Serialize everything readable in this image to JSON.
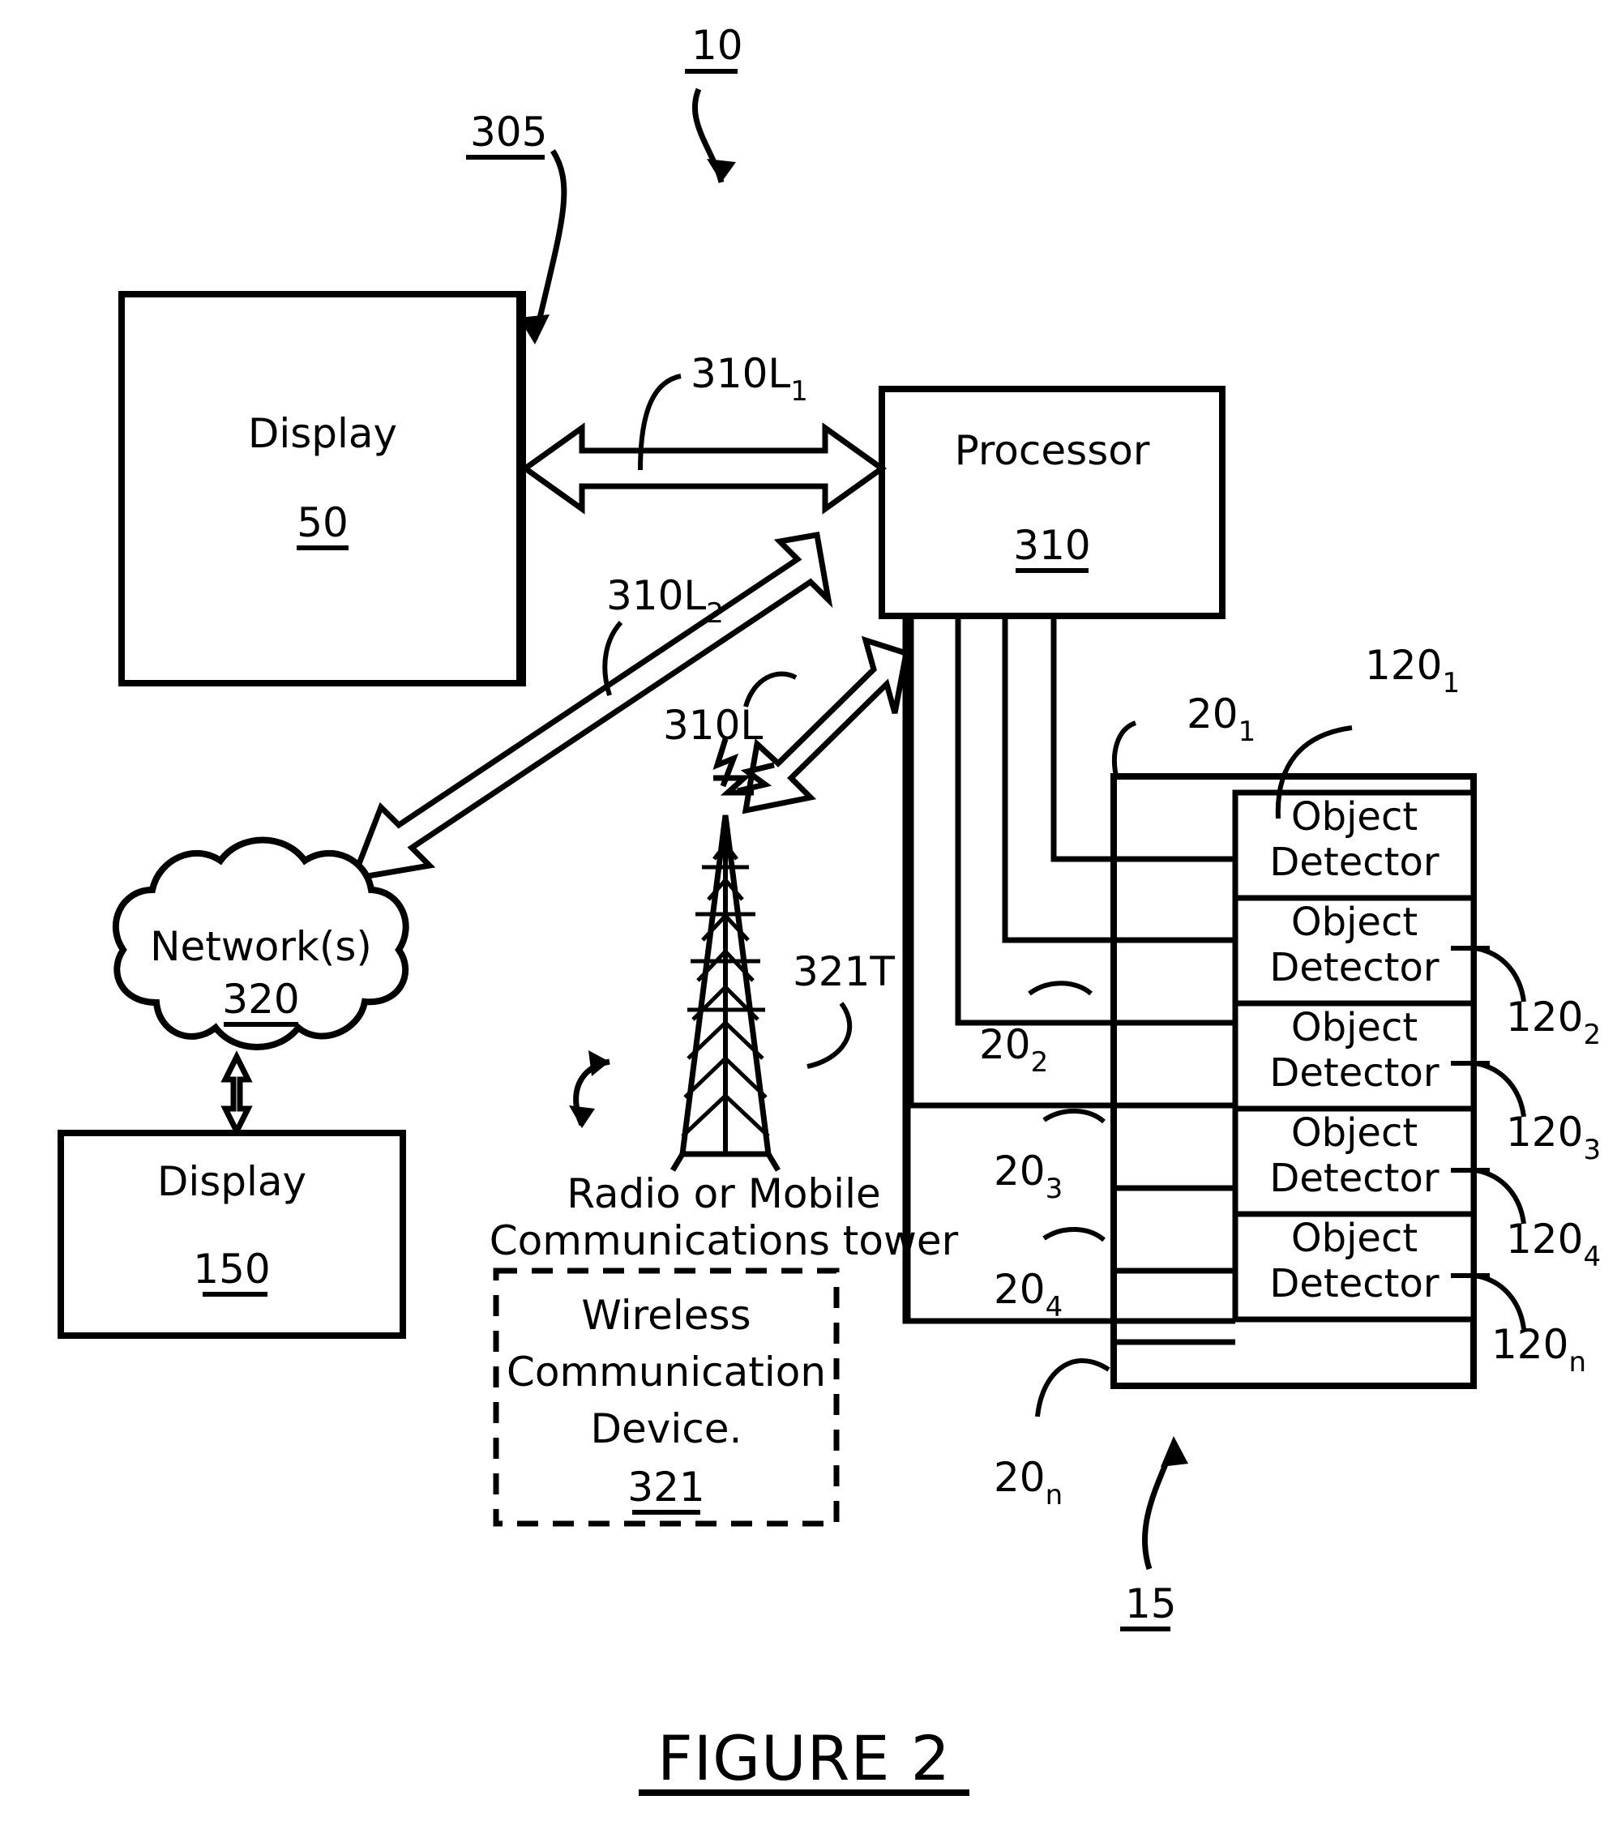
{
  "figure": {
    "caption": "FIGURE 2",
    "system_ref": "10"
  },
  "blocks": {
    "display_top": {
      "label": "Display",
      "ref": "50",
      "bezel_ref": "305"
    },
    "processor": {
      "label": "Processor",
      "ref": "310"
    },
    "network": {
      "label": "Network(s)",
      "ref": "320"
    },
    "display_bottom": {
      "label": "Display",
      "ref": "150"
    },
    "tower": {
      "caption_line1": "Radio or Mobile",
      "caption_line2": "Communications tower",
      "ref": "321T"
    },
    "wireless_device": {
      "line1": "Wireless",
      "line2": "Communication",
      "line3": "Device.",
      "ref": "321"
    },
    "detector_array": {
      "ref": "15"
    }
  },
  "links": {
    "display_processor": {
      "base": "310L",
      "sub": "1"
    },
    "network_processor": {
      "base": "310L",
      "sub": "2"
    },
    "tower_processor": {
      "base": "310L",
      "sub": ""
    }
  },
  "detectors": [
    {
      "line1": "Object",
      "line2": "Detector",
      "ref_base": "120",
      "ref_sub": "1",
      "bus_base": "20",
      "bus_sub": "1"
    },
    {
      "line1": "Object",
      "line2": "Detector",
      "ref_base": "120",
      "ref_sub": "2",
      "bus_base": "20",
      "bus_sub": "2"
    },
    {
      "line1": "Object",
      "line2": "Detector",
      "ref_base": "120",
      "ref_sub": "3",
      "bus_base": "20",
      "bus_sub": "3"
    },
    {
      "line1": "Object",
      "line2": "Detector",
      "ref_base": "120",
      "ref_sub": "4",
      "bus_base": "20",
      "bus_sub": "4"
    },
    {
      "line1": "Object",
      "line2": "Detector",
      "ref_base": "120",
      "ref_sub": "n",
      "bus_base": "20",
      "bus_sub": "n"
    }
  ],
  "colors": {
    "ink": "#000000",
    "paper": "#ffffff"
  }
}
